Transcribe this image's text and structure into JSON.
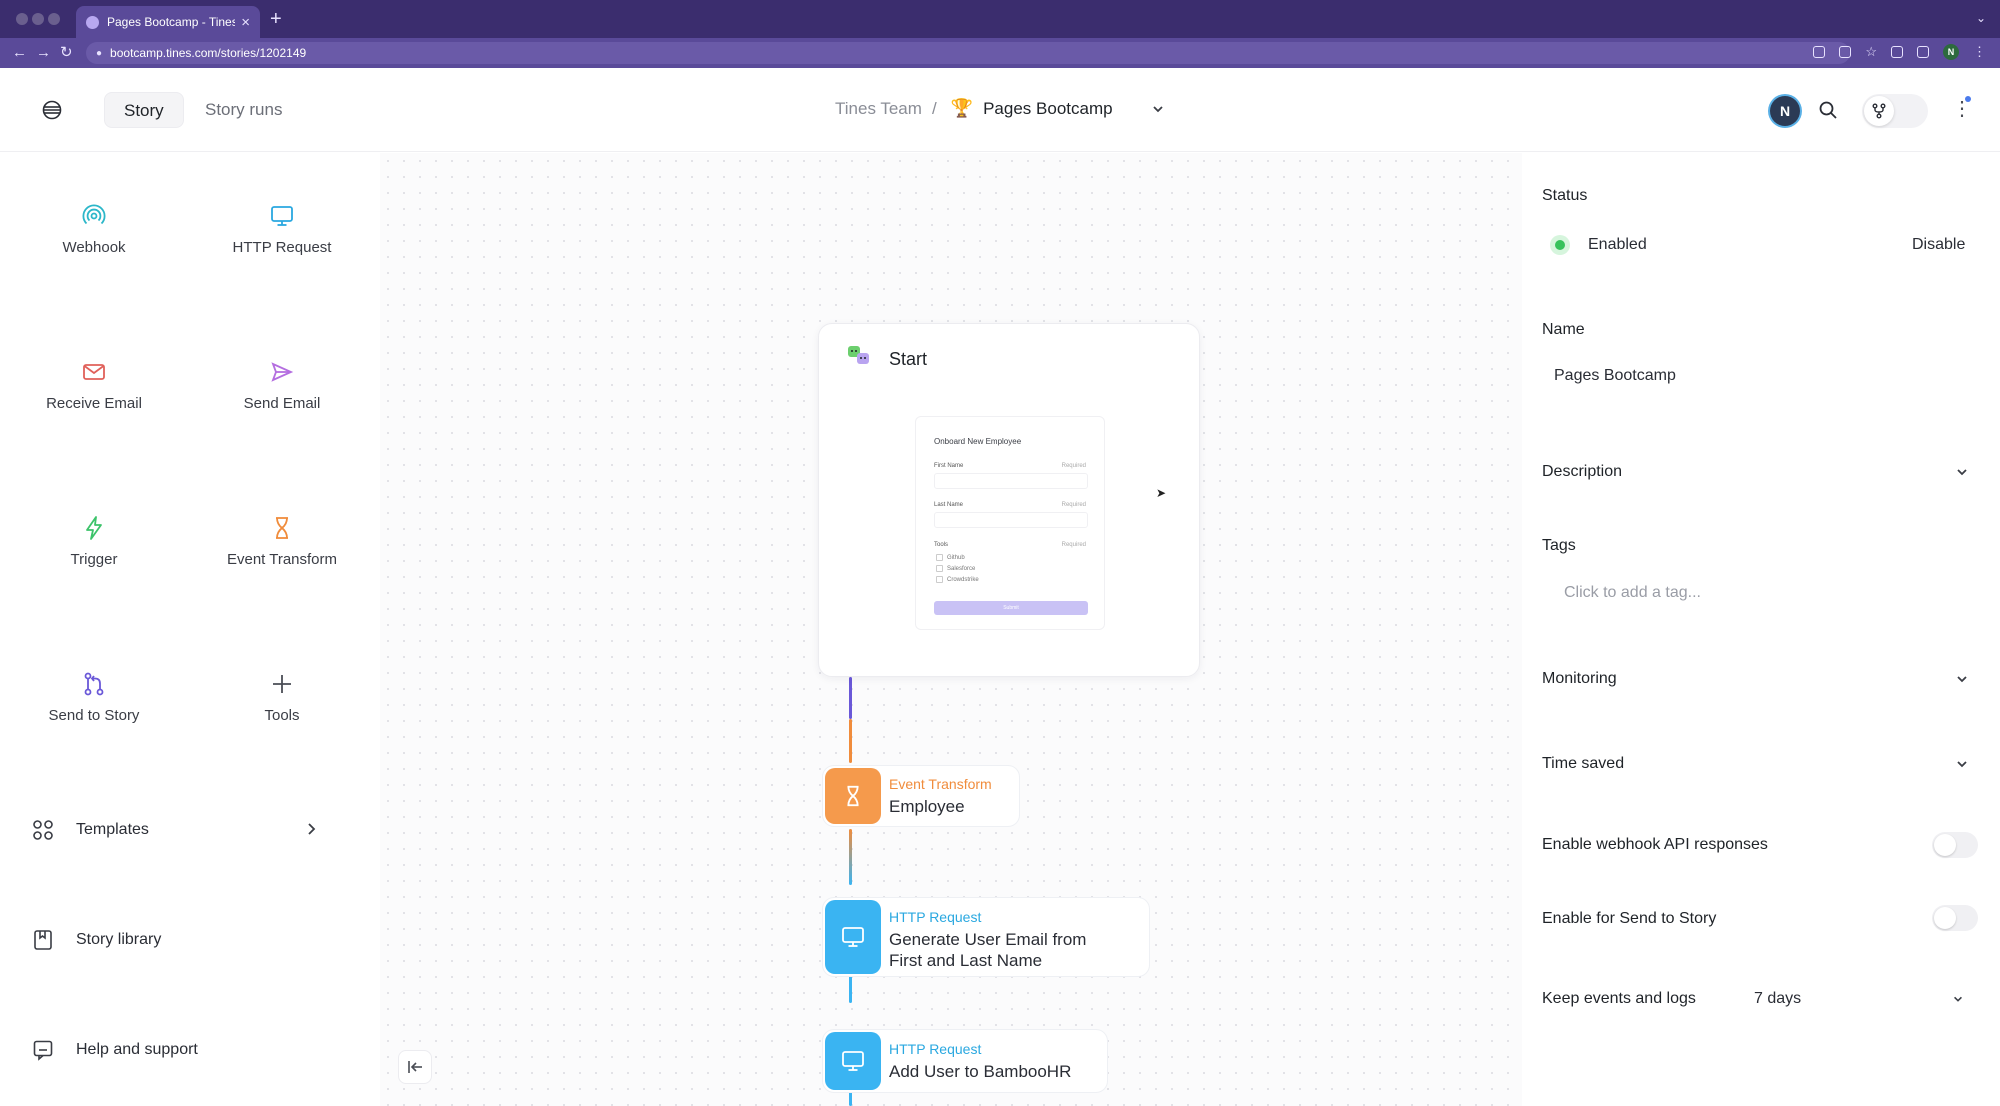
{
  "browser": {
    "tab_title": "Pages Bootcamp - Tines",
    "url": "bootcamp.tines.com/stories/1202149",
    "profile_initial": "N"
  },
  "header": {
    "tabs": [
      {
        "label": "Story",
        "active": true
      },
      {
        "label": "Story runs",
        "active": false
      }
    ],
    "breadcrumb": {
      "team": "Tines Team",
      "separator": "/",
      "story": "Pages Bootcamp"
    },
    "avatar_initial": "N"
  },
  "sidebar": {
    "tiles": [
      {
        "label": "Webhook",
        "icon": "webhook-icon",
        "color": "#2bb7c9"
      },
      {
        "label": "HTTP Request",
        "icon": "monitor-icon",
        "color": "#2aa8e0"
      },
      {
        "label": "Receive Email",
        "icon": "envelope-icon",
        "color": "#e0605a"
      },
      {
        "label": "Send Email",
        "icon": "send-icon",
        "color": "#b46ee0"
      },
      {
        "label": "Trigger",
        "icon": "lightning-icon",
        "color": "#3cc36a"
      },
      {
        "label": "Event Transform",
        "icon": "hourglass-icon",
        "color": "#f08c3c"
      },
      {
        "label": "Send to Story",
        "icon": "branch-icon",
        "color": "#6a58d8"
      },
      {
        "label": "Tools",
        "icon": "plus-icon",
        "color": "#4a4d55"
      }
    ],
    "rows": [
      {
        "label": "Templates",
        "icon": "grid-icon"
      },
      {
        "label": "Story library",
        "icon": "book-icon"
      },
      {
        "label": "Help and support",
        "icon": "chat-icon"
      }
    ]
  },
  "canvas": {
    "start": {
      "title": "Start",
      "form": {
        "title": "Onboard New Employee",
        "fields": [
          {
            "label": "First Name",
            "hint": "Required"
          },
          {
            "label": "Last Name",
            "hint": "Required"
          },
          {
            "label": "Tools",
            "hint": "Required"
          }
        ],
        "options": [
          "Github",
          "Salesforce",
          "Crowdstrike"
        ],
        "submit": "Submit"
      }
    },
    "nodes": [
      {
        "kind": "Event Transform",
        "name": "Employee",
        "color": "#f59a4c"
      },
      {
        "kind": "HTTP Request",
        "name_lines": [
          "Generate User Email from",
          "First and Last Name"
        ],
        "color": "#3ab4f2"
      },
      {
        "kind": "HTTP Request",
        "name": "Add User to BambooHR",
        "color": "#3ab4f2"
      }
    ]
  },
  "panel": {
    "status": {
      "label": "Status",
      "value": "Enabled",
      "action": "Disable"
    },
    "name": {
      "label": "Name",
      "value": "Pages Bootcamp"
    },
    "description": {
      "label": "Description"
    },
    "tags": {
      "label": "Tags",
      "placeholder": "Click to add a tag..."
    },
    "monitoring": {
      "label": "Monitoring"
    },
    "time_saved": {
      "label": "Time saved"
    },
    "webhook_api": {
      "label": "Enable webhook API responses",
      "enabled": false
    },
    "send_to_story": {
      "label": "Enable for Send to Story",
      "enabled": false
    },
    "keep_events": {
      "label": "Keep events and logs",
      "value": "7 days"
    }
  },
  "colors": {
    "browser_chrome": "#3b2d6e",
    "status_enabled": "#37c25c",
    "event_transform": "#f59a4c",
    "http_request": "#3ab4f2",
    "flow_top": "#6a58d8"
  }
}
